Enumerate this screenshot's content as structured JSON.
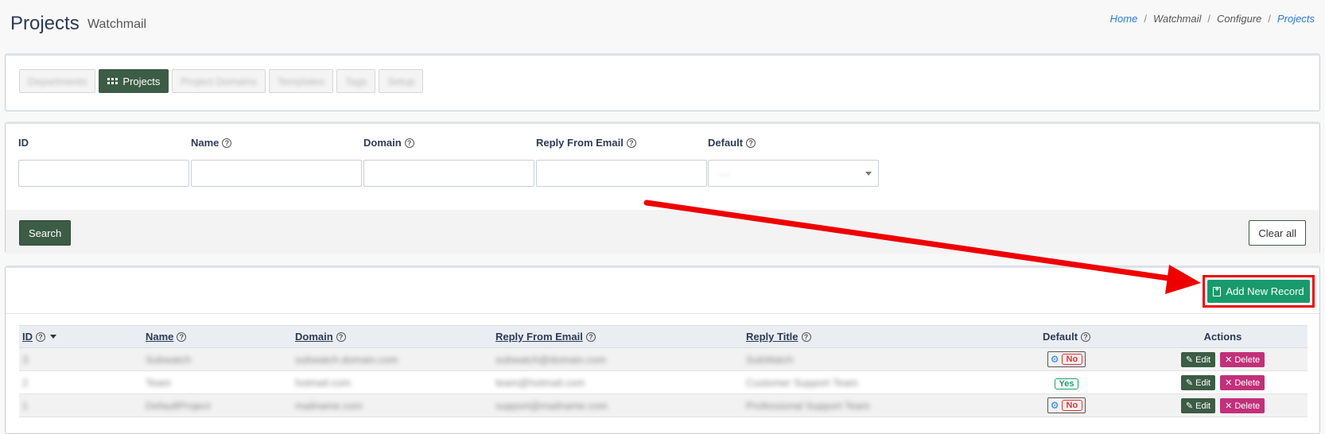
{
  "header": {
    "title": "Projects",
    "subtitle": "Watchmail",
    "breadcrumb": [
      "Home",
      "Watchmail",
      "Configure",
      "Projects"
    ]
  },
  "tabs": [
    {
      "label": "Departments",
      "active": false
    },
    {
      "label": "Projects",
      "active": true
    },
    {
      "label": "Project Domains",
      "active": false
    },
    {
      "label": "Templates",
      "active": false
    },
    {
      "label": "Tags",
      "active": false
    },
    {
      "label": "Setup",
      "active": false
    }
  ],
  "filters": {
    "id_label": "ID",
    "name_label": "Name",
    "domain_label": "Domain",
    "reply_label": "Reply From Email",
    "default_label": "Default",
    "default_value": "---",
    "search_label": "Search",
    "clear_label": "Clear all",
    "help_glyph": "?"
  },
  "table": {
    "add_label": "Add New Record",
    "columns": {
      "id": "ID",
      "name": "Name",
      "domain": "Domain",
      "reply_email": "Reply From Email",
      "reply_title": "Reply Title",
      "default": "Default",
      "actions": "Actions"
    },
    "edit_label": "Edit",
    "delete_label": "Delete",
    "delete_glyph": "✕",
    "rows": [
      {
        "id": "3",
        "name": "Subwatch",
        "domain": "subwatch.domain.com",
        "email": "subwatch@domain.com",
        "title": "SubWatch",
        "default": "No"
      },
      {
        "id": "2",
        "name": "Team",
        "domain": "hotmail.com",
        "email": "team@hotmail.com",
        "title": "Customer Support Team",
        "default": "Yes"
      },
      {
        "id": "1",
        "name": "DefaultProject",
        "domain": "mailname.com",
        "email": "support@mailname.com",
        "title": "Professional Support Team",
        "default": "No"
      }
    ]
  },
  "colors": {
    "primary": "#3c5c45",
    "add": "#189a6c",
    "delete": "#c2307a",
    "highlight": "#ee0000"
  }
}
